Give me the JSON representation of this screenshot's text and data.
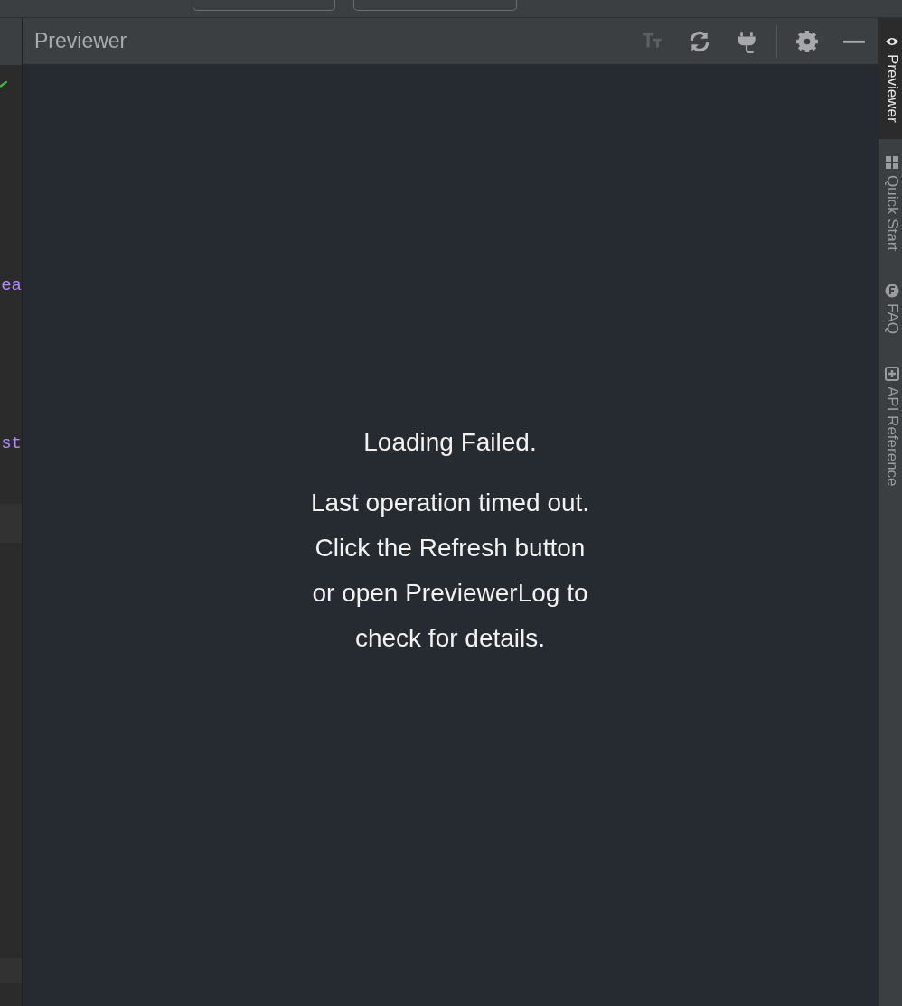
{
  "editor": {
    "fragments": [
      {
        "text": "ea"
      },
      {
        "text": "st"
      }
    ]
  },
  "panel": {
    "title": "Previewer",
    "tools": [
      {
        "kind": "font-size",
        "disabled": true
      },
      {
        "kind": "refresh",
        "disabled": false
      },
      {
        "kind": "plug",
        "disabled": false
      },
      {
        "kind": "settings",
        "disabled": false
      },
      {
        "kind": "minimize",
        "disabled": false
      }
    ]
  },
  "message": {
    "title": "Loading Failed.",
    "lines": [
      "Last operation timed out.",
      "Click the Refresh button",
      "or open PreviewerLog to",
      "check for details."
    ]
  },
  "side_tabs": [
    {
      "label": "Previewer",
      "kind": "eye",
      "selected": true
    },
    {
      "label": "Quick Start",
      "kind": "grid",
      "selected": false
    },
    {
      "label": "FAQ",
      "kind": "faq",
      "selected": false
    },
    {
      "label": "API Reference",
      "kind": "api",
      "selected": false
    }
  ]
}
